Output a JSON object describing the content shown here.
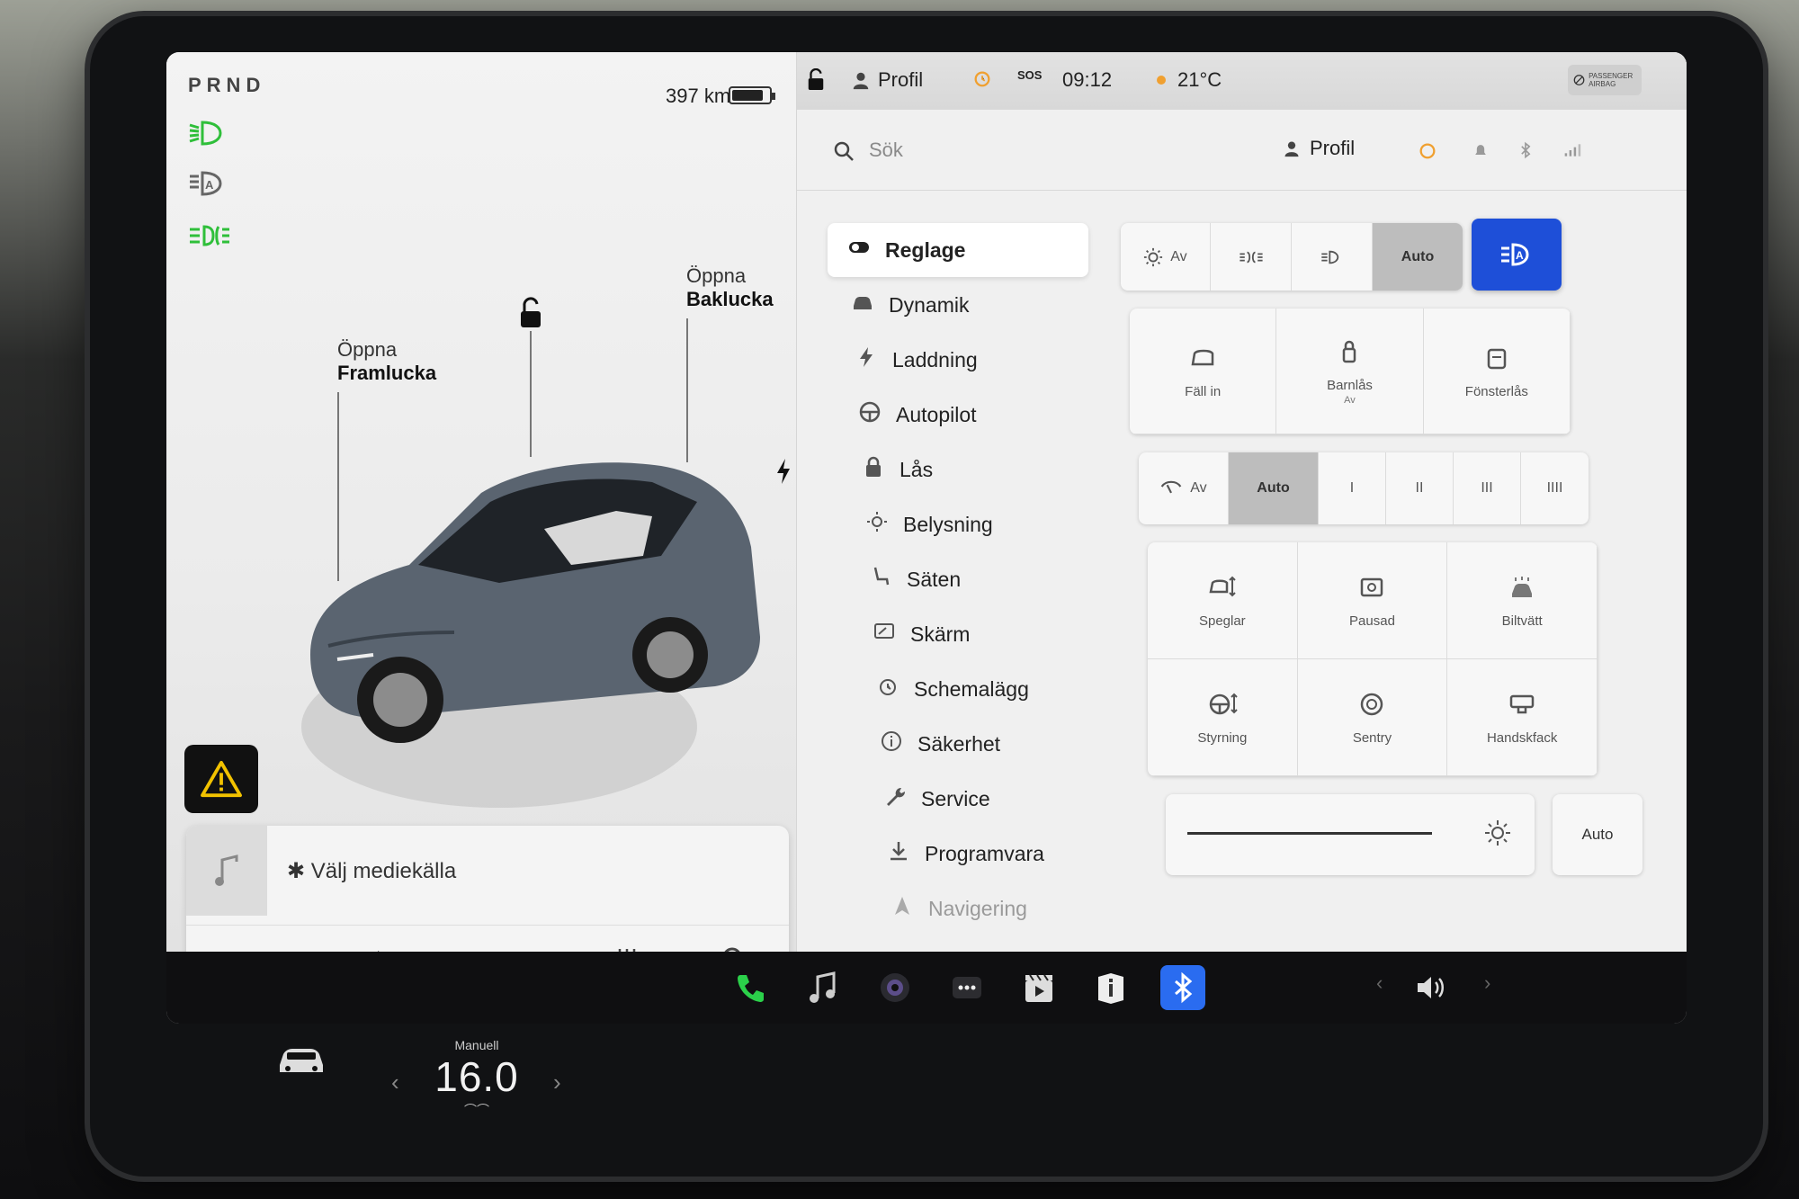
{
  "left_panel": {
    "prnd": "PRND",
    "range": "397 km",
    "battery_level": 0.85,
    "lamp_icons": [
      "low-beam-icon",
      "auto-high-beam-icon",
      "fog-lights-icon"
    ],
    "front_trunk": {
      "line1": "Öppna",
      "line2": "Framlucka"
    },
    "rear_trunk": {
      "line1": "Öppna",
      "line2": "Baklucka"
    }
  },
  "media": {
    "source_label": "Välj mediekälla",
    "controls": [
      "previous",
      "play",
      "next",
      "equalizer",
      "search"
    ]
  },
  "status_bar": {
    "profile": "Profil",
    "sos": "SOS",
    "time": "09:12",
    "temperature": "21°C",
    "airbag": "PASSENGER AIRBAG"
  },
  "search": {
    "placeholder": "Sök",
    "profile": "Profil"
  },
  "menu": {
    "items": [
      {
        "label": "Reglage",
        "icon": "toggle-icon"
      },
      {
        "label": "Dynamik",
        "icon": "car-icon"
      },
      {
        "label": "Laddning",
        "icon": "bolt-icon"
      },
      {
        "label": "Autopilot",
        "icon": "steering-wheel-icon"
      },
      {
        "label": "Lås",
        "icon": "lock-icon"
      },
      {
        "label": "Belysning",
        "icon": "sun-icon"
      },
      {
        "label": "Säten",
        "icon": "seat-icon"
      },
      {
        "label": "Skärm",
        "icon": "display-icon"
      },
      {
        "label": "Schemalägg",
        "icon": "alarm-icon"
      },
      {
        "label": "Säkerhet",
        "icon": "info-icon"
      },
      {
        "label": "Service",
        "icon": "wrench-icon"
      },
      {
        "label": "Programvara",
        "icon": "download-icon"
      },
      {
        "label": "Navigering",
        "icon": "navigation-icon"
      }
    ]
  },
  "lights": {
    "options": [
      "Av",
      "",
      "",
      "Auto"
    ],
    "selected": "Auto"
  },
  "tiles_row1": [
    {
      "label": "Fäll in",
      "sub": ""
    },
    {
      "label": "Barnlås",
      "sub": "Av"
    },
    {
      "label": "Fönsterlås",
      "sub": ""
    }
  ],
  "wipers": {
    "options": [
      "Av",
      "Auto",
      "I",
      "II",
      "III",
      "IIII"
    ],
    "selected": "Auto"
  },
  "tiles_grid": [
    {
      "label": "Speglar"
    },
    {
      "label": "Pausad"
    },
    {
      "label": "Biltvätt"
    },
    {
      "label": "Styrning"
    },
    {
      "label": "Sentry"
    },
    {
      "label": "Handskfack"
    }
  ],
  "display": {
    "brightness": 0.85,
    "auto_label": "Auto"
  },
  "dock": {
    "climate_mode": "Manuell",
    "temperature": "16.0"
  },
  "colors": {
    "accent_blue": "#1e4fd8",
    "lamp_green": "#2fbf3a",
    "phone_green": "#2bd04a",
    "bluetooth_blue": "#2a6cf0"
  }
}
